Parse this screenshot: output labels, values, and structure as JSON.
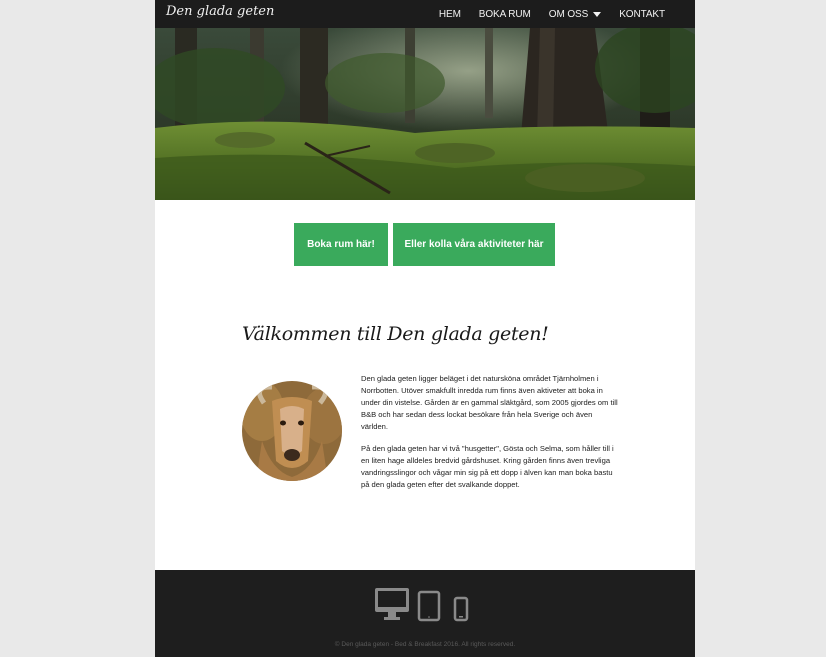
{
  "nav": {
    "brand": "Den glada geten",
    "items": [
      {
        "label": "HEM"
      },
      {
        "label": "BOKA RUM"
      },
      {
        "label": "OM OSS",
        "has_dropdown": true
      },
      {
        "label": "KONTAKT"
      }
    ]
  },
  "cta": {
    "book_label": "Boka rum här!",
    "activities_label": "Eller kolla våra aktiviteter här",
    "color": "#3aaa5c"
  },
  "welcome": {
    "title": "Välkommen till Den glada geten!",
    "paragraphs": [
      "Den glada geten ligger beläget i det naturskönа området Tjärnholmen i Norrbotten. Utöver smakfullt inredda rum finns även aktiveter att boka in under din vistelse. Gården är en gammal släktgård, som 2005 gjordes om till B&B och har sedan dess lockat besökare från hela Sverige och även världen.",
      "På den glada geten har vi två \"husgetter\", Gösta och Selma, som håller till i en liten hage alldeles bredvid gårdshuset. Kring gården finns även trevliga vandringsslingor och vågar min sig på ett dopp i älven kan man boka bastu på den glada geten efter det svalkande doppet."
    ]
  },
  "footer": {
    "device_icons": [
      "desktop-icon",
      "tablet-icon",
      "phone-icon"
    ],
    "copyright": "© Den glada geten - Bed & Breakfast 2016. All rights reserved."
  }
}
